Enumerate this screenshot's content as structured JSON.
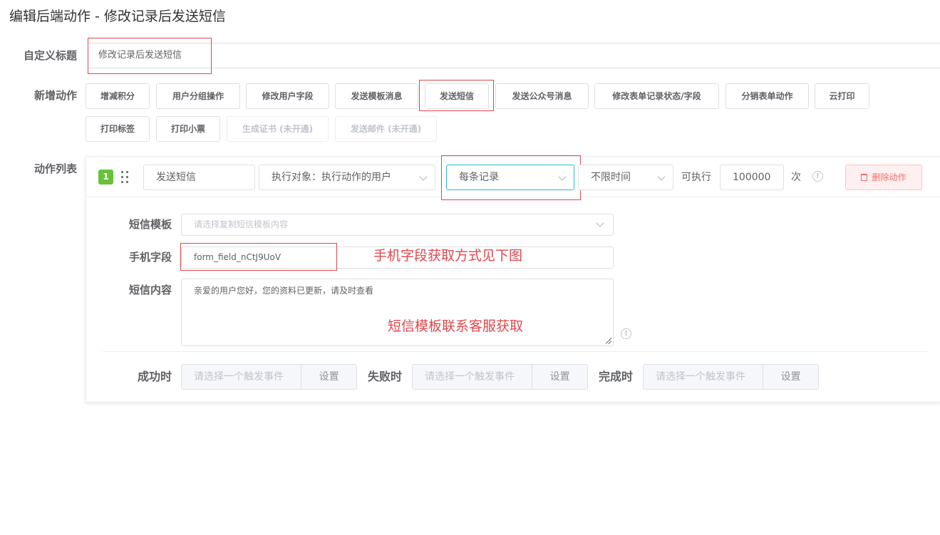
{
  "page": {
    "title": "编辑后端动作 - 修改记录后发送短信"
  },
  "custom_title": {
    "label": "自定义标题",
    "value": "修改记录后发送短信"
  },
  "add_action": {
    "label": "新增动作",
    "buttons": [
      {
        "label": "增减积分",
        "disabled": false
      },
      {
        "label": "用户分组操作",
        "disabled": false
      },
      {
        "label": "修改用户字段",
        "disabled": false
      },
      {
        "label": "发送模板消息",
        "disabled": false
      },
      {
        "label": "发送短信",
        "disabled": false
      },
      {
        "label": "发送公众号消息",
        "disabled": false
      },
      {
        "label": "修改表单记录状态/字段",
        "disabled": false
      },
      {
        "label": "分销表单动作",
        "disabled": false
      },
      {
        "label": "云打印",
        "disabled": false
      },
      {
        "label": "打印标签",
        "disabled": false
      },
      {
        "label": "打印小票",
        "disabled": false
      },
      {
        "label": "生成证书 (未开通)",
        "disabled": true
      },
      {
        "label": "发送邮件 (未开通)",
        "disabled": true
      }
    ]
  },
  "action_list": {
    "label": "动作列表",
    "item": {
      "index": "1",
      "name": "发送短信",
      "target": "执行对象：执行动作的用户",
      "scope": "每条记录",
      "time": "不限时间",
      "exec_prefix": "可执行",
      "exec_count": "100000",
      "exec_suffix": "次",
      "delete_label": "删除动作"
    },
    "sms_template": {
      "label": "短信模板",
      "placeholder": "请选择复制短信模板内容"
    },
    "phone_field": {
      "label": "手机字段",
      "value": "form_field_nCtJ9UoV"
    },
    "sms_content": {
      "label": "短信内容",
      "value": "亲爱的用户您好，您的资料已更新，请及时查看"
    },
    "annotations": {
      "phone_note": "手机字段获取方式见下图",
      "template_note": "短信模板联系客服获取"
    },
    "events": [
      {
        "label": "成功时",
        "placeholder": "请选择一个触发事件",
        "button": "设置"
      },
      {
        "label": "失败时",
        "placeholder": "请选择一个触发事件",
        "button": "设置"
      },
      {
        "label": "完成时",
        "placeholder": "请选择一个触发事件",
        "button": "设置"
      }
    ]
  },
  "colors": {
    "accent_red": "#e0474c",
    "badge_green": "#67c23a",
    "focus_border": "#2bb6d6",
    "delete_red": "#f56c6c"
  }
}
